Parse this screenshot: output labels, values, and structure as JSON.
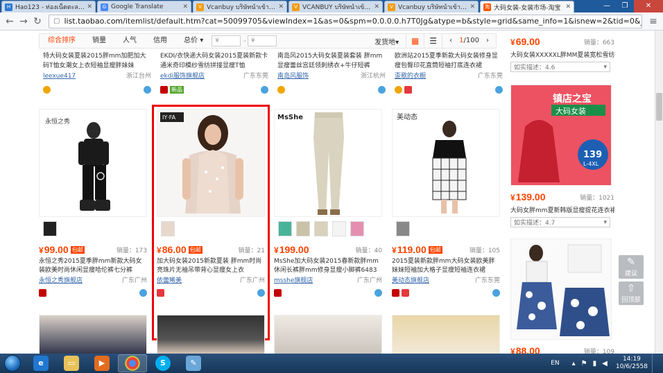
{
  "browser": {
    "tabs": [
      {
        "title": "Hao123 - ท่องเน็ตตะลาดบน่ะ",
        "favicon_color": "#2d7bd3",
        "favicon_text": "H"
      },
      {
        "title": "Google Translate",
        "favicon_color": "#4a8af4",
        "favicon_text": "G"
      },
      {
        "title": "Vcanbuy บริษัทนำเข้าสินค้าจากจีน",
        "favicon_color": "#f39c12",
        "favicon_text": "V"
      },
      {
        "title": "VCANBUY บริษัทนำเข้าสินค้าจา",
        "favicon_color": "#f39c12",
        "favicon_text": "V"
      },
      {
        "title": "Vcanbuy บริษัทนำเข้าสินค้าจากจ",
        "favicon_color": "#f39c12",
        "favicon_text": "V"
      },
      {
        "title": "大码女装-女装市场-淘宝",
        "favicon_color": "#ff5500",
        "favicon_text": "淘"
      }
    ],
    "active_tab": 5,
    "url_host": "list.taobao.com",
    "url_path": "/itemlist/default.htm?cat=50099705&viewIndex=1&as=0&spm=0.0.0.0.h7T0Jg&atype=b&style=grid&same_info=1&isnew=2&tid=0&_input_char"
  },
  "sortbar": {
    "items": [
      "综合排序",
      "销量",
      "人气",
      "信用",
      "总价"
    ],
    "price_from_placeholder": "¥",
    "price_to_placeholder": "¥",
    "ship_from": "发货地",
    "page": "1",
    "page_total": "/100"
  },
  "top_row": [
    {
      "title": "特大码女装夏装2015胖mm加肥加大码T恤女潮女上衣短袖显瘦胖妹妹",
      "shop": "leexue417",
      "location": "浙江台州"
    },
    {
      "title": "EKDI/衣快递大码女装2015夏装新款卡通米奇印模纱雪纺拼接显瘦T恤",
      "shop": "ekdi服饰旗舰店",
      "location": "广东东莞",
      "badge": "新品"
    },
    {
      "title": "南岛风2015大码女装夏装套装 胖mm显瘦蕾丝宫廷领刺绣衣+牛仔短裤",
      "shop": "南岛风服饰",
      "location": "浙江杭州"
    },
    {
      "title": "欧洲站2015夏季新款大码女装修身显瘦包臀印花直筒短袖打底连衣裙",
      "shop": "歪歌的衣橱",
      "location": "广东东莞"
    }
  ],
  "products": [
    {
      "price": "99.00",
      "baoyou": "包邮",
      "sold": "销量：173",
      "title": "永恒之秀2015夏季胖mm新款大码女装欧美时尚休闲显瘦哈伦裤七分裤",
      "shop": "永恒之秀旗舰店",
      "location": "广东广州",
      "brand": "永恒之秀"
    },
    {
      "price": "86.00",
      "baoyou": "包邮",
      "sold": "销量：21",
      "title": "加大码女装2015新款夏装 胖mm时尚亮珠片无袖吊带背心显瘦女上衣",
      "shop": "依蕾晞美",
      "location": "广东广州",
      "brand": "IY·FA"
    },
    {
      "price": "199.00",
      "baoyou": "",
      "sold": "销量：40",
      "title": "MsShe加大码女装2015春新款胖mm休闲长裤胖mm修身显瘦小脚裤6483",
      "shop": "msshe旗舰店",
      "location": "广东广州",
      "brand": "MsShe"
    },
    {
      "price": "119.00",
      "baoyou": "包邮",
      "sold": "销量：105",
      "title": "2015夏装新款胖mm大码女装欧美胖妹妹短袖加大格子显瘦短袖连衣裙",
      "shop": "美动态旗舰店",
      "location": "广东东莞",
      "brand": "美动态"
    }
  ],
  "right_column": [
    {
      "price": "69.00",
      "sold": "销量：663",
      "title": "大码女装XXXXXL胖MM夏装宽松雪纺",
      "rating": "如实描述：4.6"
    },
    {
      "price": "139.00",
      "sold": "销量：1021",
      "title": "大码女胖mm夏新韩版显瘦提花连衣裙",
      "rating": "如实描述：4.7",
      "promo_text": "镇店之宝",
      "promo_sub": "大码女装",
      "size_badge": "139",
      "size_range": "L-4XL"
    },
    {
      "price": "88.00",
      "sold": "销量：109"
    }
  ],
  "side_buttons": [
    {
      "label": "建议",
      "glyph": "✎"
    },
    {
      "label": "回顶部",
      "glyph": "⇧"
    }
  ],
  "taskbar": {
    "lang": "EN",
    "time": "14:19",
    "date": "10/6/2558"
  },
  "colors": {
    "accent": "#ff4400",
    "highlight_border": "#ee0000",
    "taskbar": "#1f4470"
  }
}
